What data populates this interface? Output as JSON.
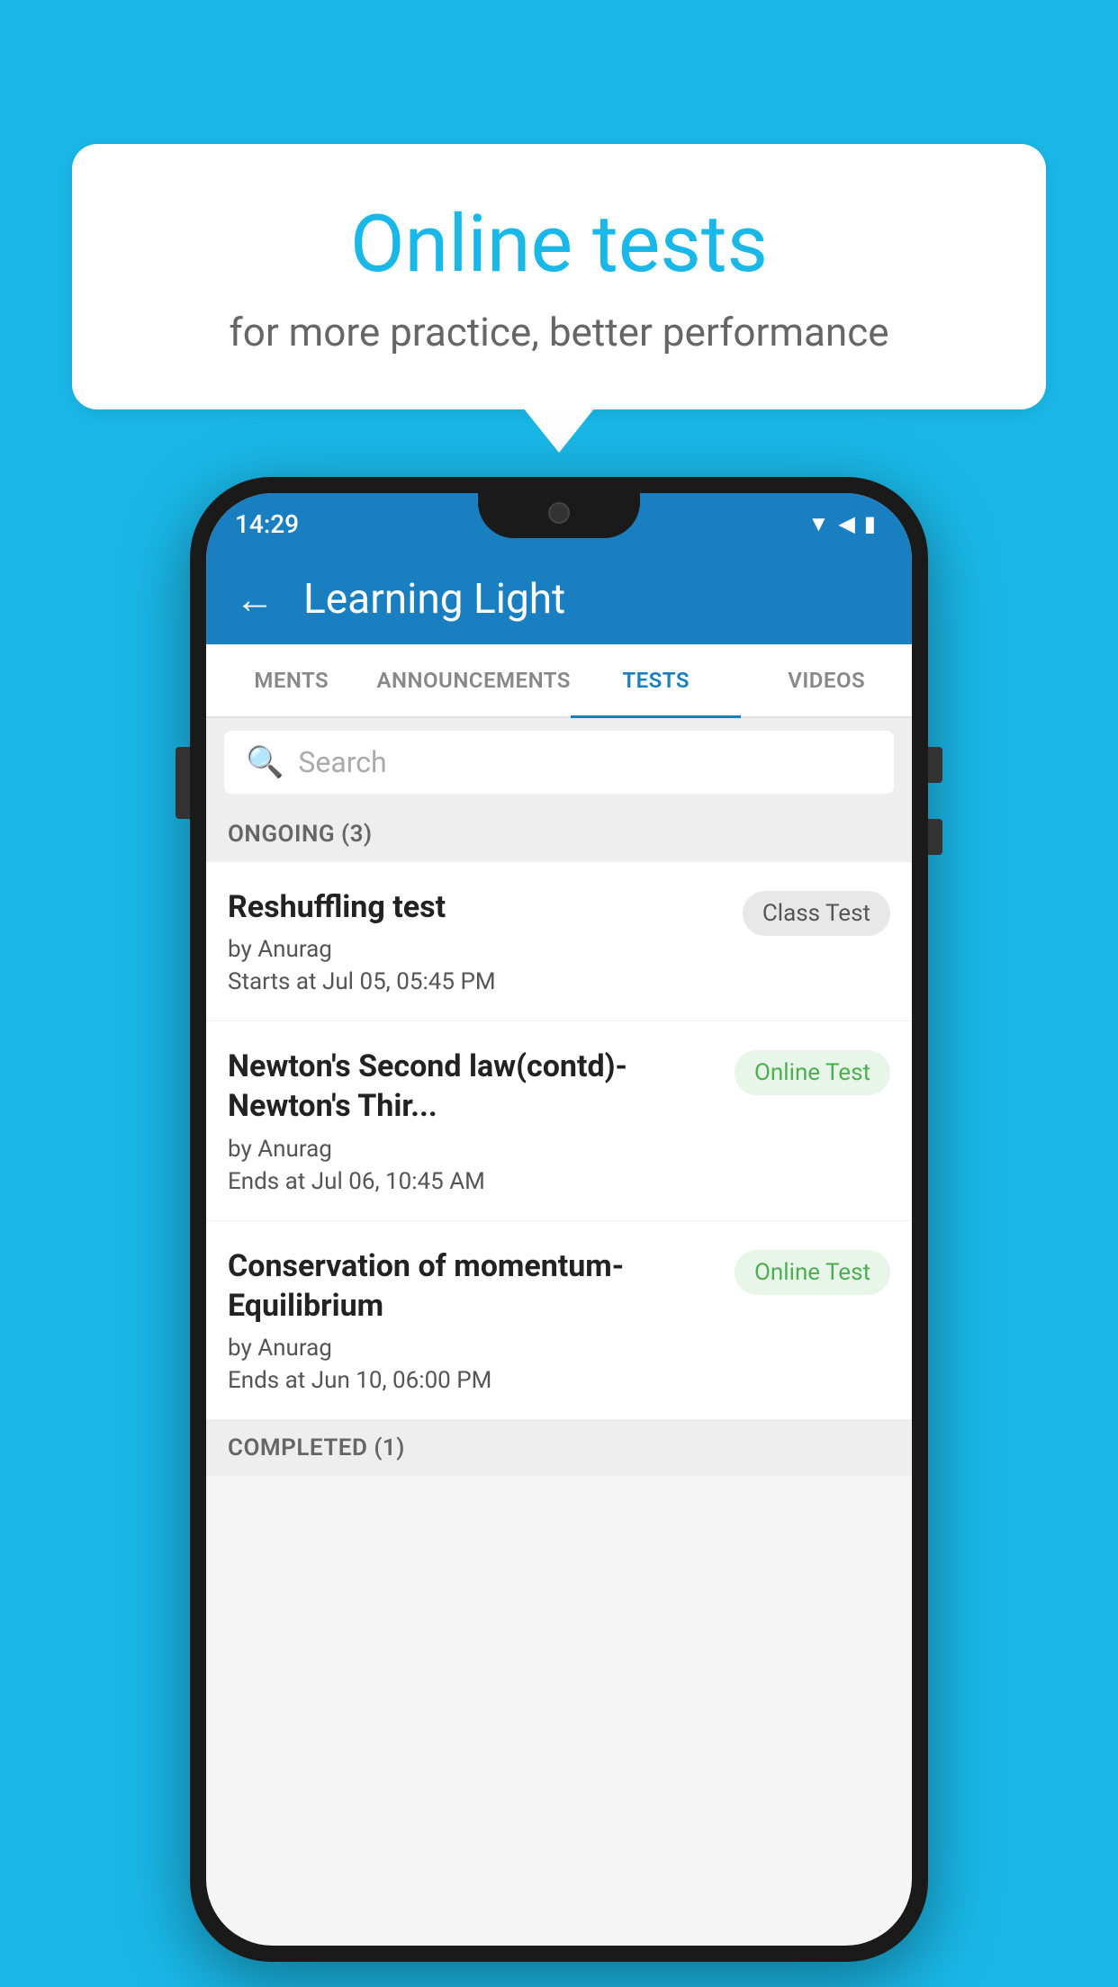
{
  "background": {
    "color": "#1ab8e8"
  },
  "speech_bubble": {
    "title": "Online tests",
    "subtitle": "for more practice, better performance"
  },
  "phone": {
    "status_bar": {
      "time": "14:29",
      "icons": [
        "wifi",
        "signal",
        "battery"
      ]
    },
    "app_bar": {
      "title": "Learning Light",
      "back_label": "←"
    },
    "tabs": [
      {
        "label": "MENTS",
        "active": false
      },
      {
        "label": "ANNOUNCEMENTS",
        "active": false
      },
      {
        "label": "TESTS",
        "active": true
      },
      {
        "label": "VIDEOS",
        "active": false
      }
    ],
    "search": {
      "placeholder": "Search"
    },
    "sections": [
      {
        "title": "ONGOING (3)",
        "tests": [
          {
            "name": "Reshuffling test",
            "by": "by Anurag",
            "date": "Starts at  Jul 05, 05:45 PM",
            "badge": "Class Test",
            "badge_type": "class"
          },
          {
            "name": "Newton's Second law(contd)-Newton's Thir...",
            "by": "by Anurag",
            "date": "Ends at  Jul 06, 10:45 AM",
            "badge": "Online Test",
            "badge_type": "online"
          },
          {
            "name": "Conservation of momentum-Equilibrium",
            "by": "by Anurag",
            "date": "Ends at  Jun 10, 06:00 PM",
            "badge": "Online Test",
            "badge_type": "online"
          }
        ]
      },
      {
        "title": "COMPLETED (1)",
        "tests": []
      }
    ]
  }
}
